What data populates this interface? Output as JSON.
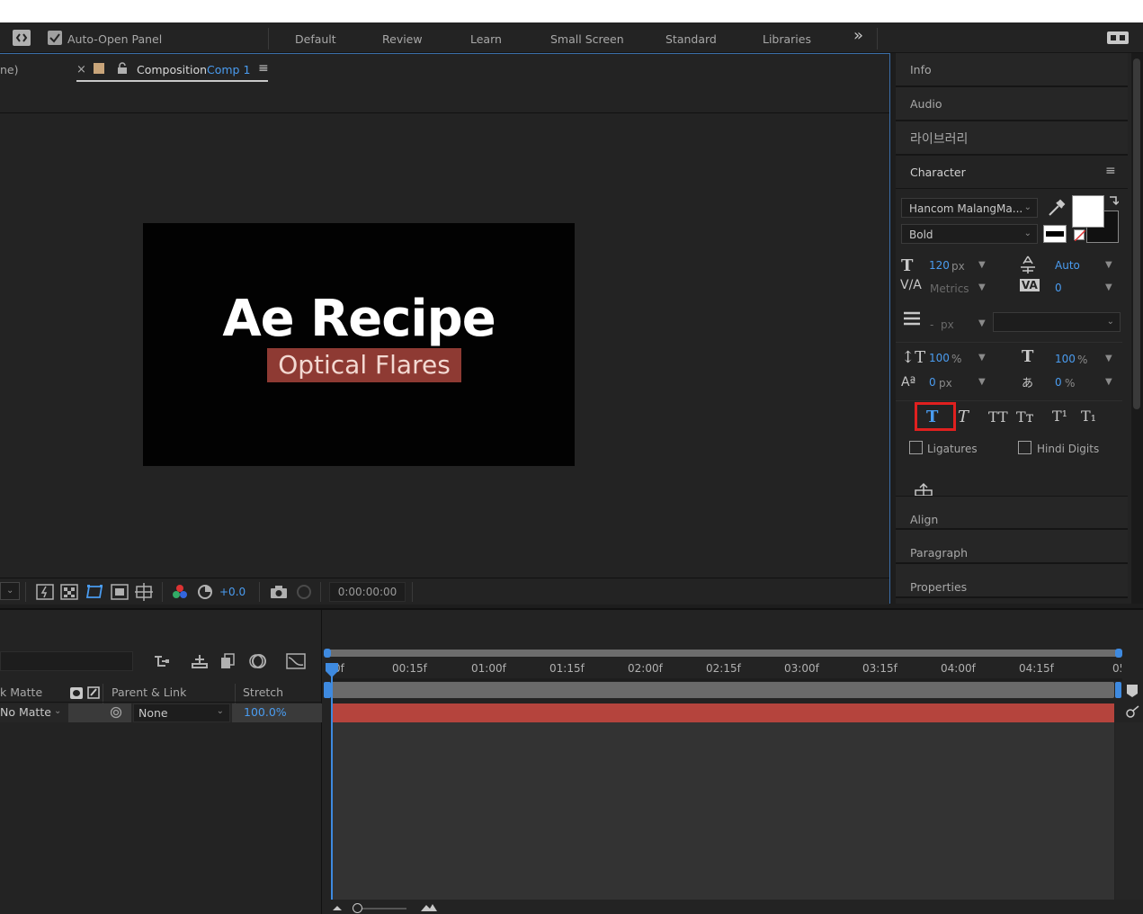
{
  "workspace": {
    "auto_open_label": "Auto-Open Panel",
    "tabs": [
      "Default",
      "Review",
      "Learn",
      "Small Screen",
      "Standard",
      "Libraries"
    ],
    "more_symbol": "»"
  },
  "comp_panel": {
    "partial_tab_label": "ne)",
    "close_symbol": "×",
    "tab_label": "Composition",
    "comp_name": "Comp 1",
    "canvas_title": "Ae Recipe",
    "canvas_subtitle": "Optical Flares",
    "exposure_value": "+0.0",
    "timecode": "0:00:00:00"
  },
  "right_panel": {
    "sections_top": [
      "Info",
      "Audio",
      "라이브러리"
    ],
    "character_title": "Character",
    "font_family": "Hancom MalangMa...",
    "font_style": "Bold",
    "font_size_value": "120",
    "font_size_unit": "px",
    "leading_value": "Auto",
    "kerning_value": "Metrics",
    "tracking_value": "0",
    "stroke_value": "-",
    "stroke_unit": "px",
    "vscale_value": "100",
    "vscale_unit": "%",
    "hscale_value": "100",
    "hscale_unit": "%",
    "baseline_value": "0",
    "baseline_unit": "px",
    "tsume_value": "0",
    "tsume_unit": "%",
    "style_buttons": [
      "T",
      "T",
      "TT",
      "Tт",
      "T¹",
      "T₁"
    ],
    "ligatures_label": "Ligatures",
    "hindi_digits_label": "Hindi Digits",
    "sections_bottom": [
      "Align",
      "Paragraph",
      "Properties"
    ]
  },
  "timeline": {
    "col_track_matte": "k Matte",
    "col_parent": "Parent & Link",
    "col_stretch": "Stretch",
    "row_matte_value": "No Matte",
    "row_parent_value": "None",
    "row_stretch_value": "100.0%",
    "ruler_labels": [
      "0f",
      "00:15f",
      "01:00f",
      "01:15f",
      "02:00f",
      "02:15f",
      "03:00f",
      "03:15f",
      "04:00f",
      "04:15f",
      "05:0("
    ]
  },
  "colors": {
    "accent_blue": "#4a9cf0",
    "layer_red": "#b5443d",
    "subtitle_bg": "#8e3a33",
    "highlight_red": "#e0201f"
  }
}
